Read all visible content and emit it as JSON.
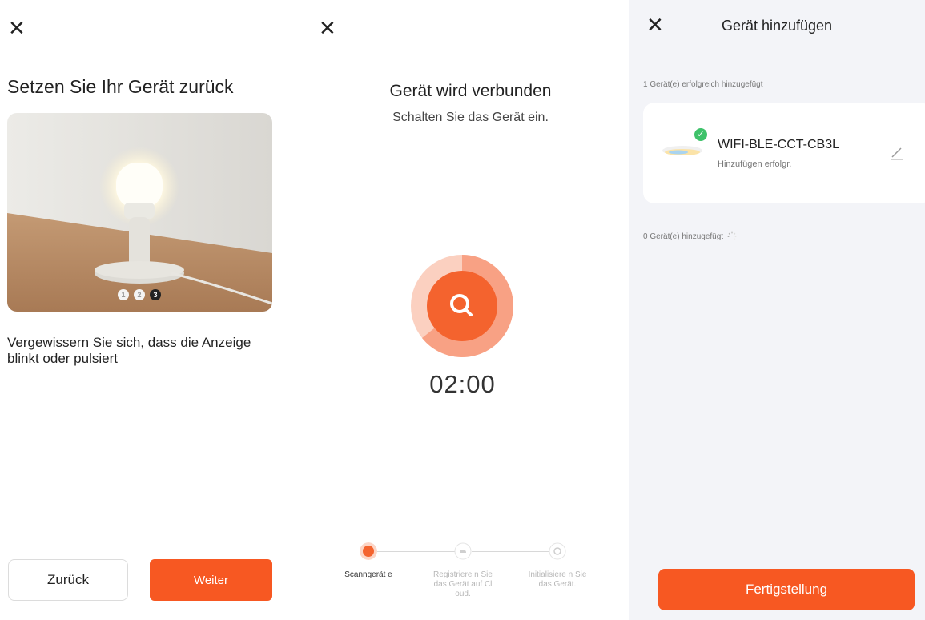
{
  "colors": {
    "accent": "#f75822",
    "success": "#3ec26a",
    "panel_bg": "#f3f4f8"
  },
  "screen1": {
    "close_icon": "close-icon",
    "title": "Setzen Sie Ihr Gerät zurück",
    "carousel_dots": [
      "1",
      "2",
      "3"
    ],
    "carousel_active": 3,
    "description": "Vergewissern Sie sich, dass die Anzeige blinkt oder pulsiert",
    "back_label": "Zurück",
    "next_label": "Weiter"
  },
  "screen2": {
    "close_icon": "close-icon",
    "title": "Gerät wird verbunden",
    "subtitle": "Schalten Sie das Gerät ein.",
    "search_icon": "search-icon",
    "timer": "02:00",
    "steps": [
      {
        "label": "Scanngerät e",
        "state": "active"
      },
      {
        "label": "Registriere n Sie das Gerät auf Cloud.",
        "state": "pending"
      },
      {
        "label": "Initialisiere n Sie das Gerät.",
        "state": "pending"
      }
    ]
  },
  "screen3": {
    "close_icon": "close-icon",
    "title": "Gerät hinzufügen",
    "success_count_text": "1 Gerät(e) erfolgreich hinzugefügt",
    "device": {
      "name": "WIFI-BLE-CCT-CB3L",
      "status": "Hinzufügen erfolgr.",
      "edit_icon": "pencil-icon"
    },
    "added_count_text": "0 Gerät(e) hinzugefügt",
    "finish_label": "Fertigstellung"
  }
}
